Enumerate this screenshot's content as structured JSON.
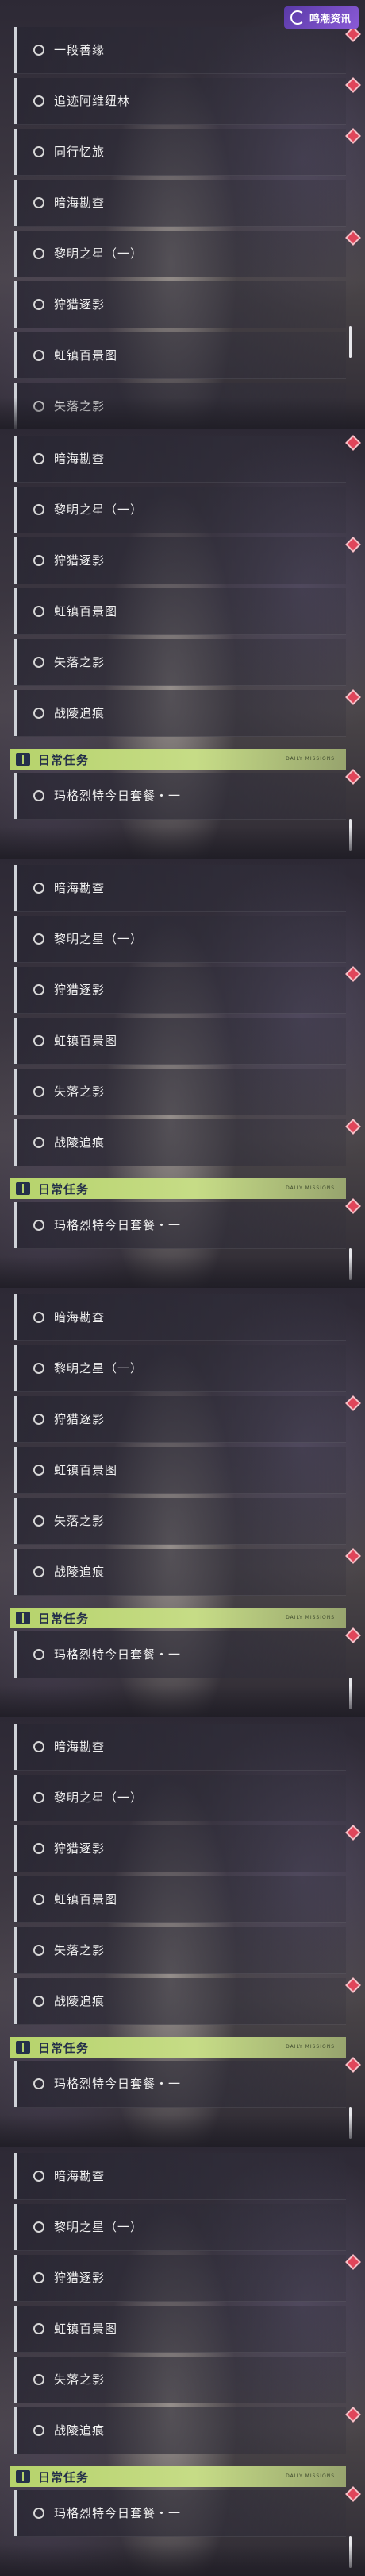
{
  "logo": {
    "text": "鸣潮资讯"
  },
  "frames": [
    {
      "items": [
        {
          "label": "一段善缘",
          "badge": true
        },
        {
          "label": "追迹阿维纽林",
          "badge": true
        },
        {
          "label": "同行忆旅",
          "badge": true
        },
        {
          "label": "暗海勘查",
          "badge": false
        },
        {
          "label": "黎明之星（一）",
          "badge": true
        },
        {
          "label": "狩猎逐影",
          "badge": false
        },
        {
          "label": "虹镇百景图",
          "badge": false
        },
        {
          "label": "失落之影",
          "badge": false
        }
      ],
      "show_section": false
    },
    {
      "items": [
        {
          "label": "暗海勘查",
          "badge": true
        },
        {
          "label": "黎明之星（一）",
          "badge": false
        },
        {
          "label": "狩猎逐影",
          "badge": true
        },
        {
          "label": "虹镇百景图",
          "badge": false
        },
        {
          "label": "失落之影",
          "badge": false
        },
        {
          "label": "战陵追痕",
          "badge": true
        }
      ],
      "show_section": true,
      "section": {
        "title": "日常任务",
        "tag": "DAILY MISSIONS"
      },
      "task": {
        "label": "玛格烈特今日套餐・一",
        "badge": true
      }
    },
    {
      "items": [
        {
          "label": "暗海勘查",
          "badge": false
        },
        {
          "label": "黎明之星（一）",
          "badge": false
        },
        {
          "label": "狩猎逐影",
          "badge": true
        },
        {
          "label": "虹镇百景图",
          "badge": false
        },
        {
          "label": "失落之影",
          "badge": false
        },
        {
          "label": "战陵追痕",
          "badge": true
        }
      ],
      "show_section": true,
      "section": {
        "title": "日常任务",
        "tag": "DAILY MISSIONS"
      },
      "task": {
        "label": "玛格烈特今日套餐・一",
        "badge": true
      }
    },
    {
      "items": [
        {
          "label": "暗海勘查",
          "badge": false
        },
        {
          "label": "黎明之星（一）",
          "badge": false
        },
        {
          "label": "狩猎逐影",
          "badge": true
        },
        {
          "label": "虹镇百景图",
          "badge": false
        },
        {
          "label": "失落之影",
          "badge": false
        },
        {
          "label": "战陵追痕",
          "badge": true
        }
      ],
      "show_section": true,
      "section": {
        "title": "日常任务",
        "tag": "DAILY MISSIONS"
      },
      "task": {
        "label": "玛格烈特今日套餐・一",
        "badge": true
      }
    },
    {
      "items": [
        {
          "label": "暗海勘查",
          "badge": false
        },
        {
          "label": "黎明之星（一）",
          "badge": false
        },
        {
          "label": "狩猎逐影",
          "badge": true
        },
        {
          "label": "虹镇百景图",
          "badge": false
        },
        {
          "label": "失落之影",
          "badge": false
        },
        {
          "label": "战陵追痕",
          "badge": true
        }
      ],
      "show_section": true,
      "section": {
        "title": "日常任务",
        "tag": "DAILY MISSIONS"
      },
      "task": {
        "label": "玛格烈特今日套餐・一",
        "badge": true
      }
    },
    {
      "items": [
        {
          "label": "暗海勘查",
          "badge": false
        },
        {
          "label": "黎明之星（一）",
          "badge": false
        },
        {
          "label": "狩猎逐影",
          "badge": true
        },
        {
          "label": "虹镇百景图",
          "badge": false
        },
        {
          "label": "失落之影",
          "badge": false
        },
        {
          "label": "战陵追痕",
          "badge": true
        }
      ],
      "show_section": true,
      "section": {
        "title": "日常任务",
        "tag": "DAILY MISSIONS"
      },
      "task": {
        "label": "玛格烈特今日套餐・一",
        "badge": true
      }
    }
  ],
  "colors": {
    "accent": "#b6d36b",
    "badge": "#e0455a"
  }
}
